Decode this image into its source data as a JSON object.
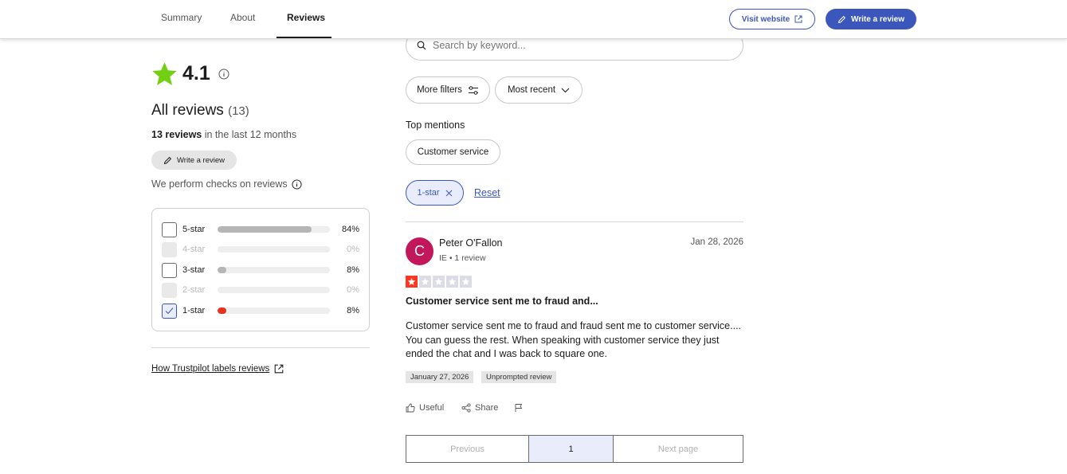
{
  "nav": {
    "tabs": [
      {
        "label": "Summary"
      },
      {
        "label": "About"
      },
      {
        "label": "Reviews"
      }
    ],
    "visit_website": "Visit website",
    "write_review": "Write a review"
  },
  "summary": {
    "rating": "4.1",
    "all_reviews_label": "All reviews",
    "all_reviews_count": "(13)",
    "reviews_count_bold": "13 reviews",
    "reviews_count_rest": " in the last 12 months",
    "write_review_small": "Write a review",
    "checks_text": "We perform checks on reviews",
    "distribution": [
      {
        "label": "5-star",
        "pct": "84%",
        "fraction": 0.84,
        "state": "normal"
      },
      {
        "label": "4-star",
        "pct": "0%",
        "fraction": 0,
        "state": "disabled"
      },
      {
        "label": "3-star",
        "pct": "8%",
        "fraction": 0.08,
        "state": "normal"
      },
      {
        "label": "2-star",
        "pct": "0%",
        "fraction": 0,
        "state": "disabled"
      },
      {
        "label": "1-star",
        "pct": "8%",
        "fraction": 0.08,
        "state": "checked"
      }
    ],
    "labels_link": "How Trustpilot labels reviews"
  },
  "filters": {
    "search_placeholder": "Search by keyword...",
    "more_filters": "More filters",
    "sort": "Most recent",
    "top_mentions_label": "Top mentions",
    "mentions": [
      "Customer service"
    ],
    "active_filter": "1-star",
    "reset": "Reset"
  },
  "review": {
    "avatar_initial": "C",
    "avatar_color": "#c2185b",
    "name": "Peter O'Fallon",
    "meta": "IE • 1 review",
    "date": "Jan 28, 2026",
    "stars": 1,
    "title": "Customer service sent me to fraud and...",
    "body": "Customer service sent me to fraud and fraud sent me to customer service.... You can guess the rest. When speaking with customer service they just ended the chat and I was back to square one.",
    "tags": [
      "January 27, 2026",
      "Unprompted review"
    ],
    "actions": {
      "useful": "Useful",
      "share": "Share"
    }
  },
  "pagination": {
    "previous": "Previous",
    "current": "1",
    "next": "Next page"
  },
  "colors": {
    "brand_blue": "#3c57bc",
    "star_green": "#73cf11",
    "star_red": "#ff3722"
  }
}
